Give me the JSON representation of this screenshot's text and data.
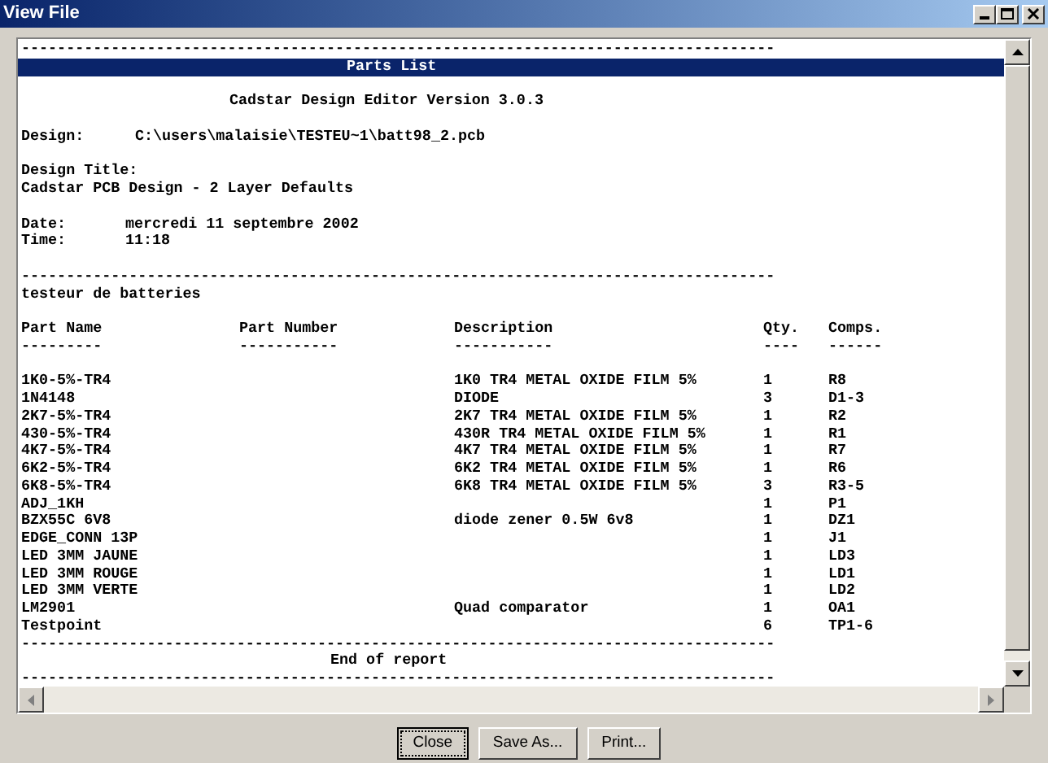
{
  "window": {
    "title": "View File"
  },
  "report": {
    "top_rule": "------------------------------------------------------------------------------------",
    "banner": "Parts List",
    "heading": "Cadstar Design Editor Version 3.0.3",
    "design": {
      "label": "Design:",
      "value": "C:\\users\\malaisie\\TESTEU~1\\batt98_2.pcb"
    },
    "design_title": {
      "label": "Design Title:",
      "value": "Cadstar PCB Design - 2 Layer Defaults"
    },
    "date": {
      "label": "Date:",
      "value": "mercredi 11 septembre 2002"
    },
    "time": {
      "label": "Time:",
      "value": "11:18"
    },
    "rule": "------------------------------------------------------------------------------------",
    "project": "testeur de batteries",
    "columns": [
      {
        "label": "Part Name",
        "underline": "---------"
      },
      {
        "label": "Part Number",
        "underline": "-----------"
      },
      {
        "label": "Description",
        "underline": "-----------"
      },
      {
        "label": "Qty.",
        "underline": "----"
      },
      {
        "label": "Comps.",
        "underline": "------"
      }
    ],
    "rows": [
      {
        "part_name": "1K0-5%-TR4",
        "description": "1K0 TR4 METAL OXIDE FILM 5%",
        "qty": "1",
        "comps": "R8"
      },
      {
        "part_name": "1N4148",
        "description": "DIODE",
        "qty": "3",
        "comps": "D1-3"
      },
      {
        "part_name": "2K7-5%-TR4",
        "description": "2K7 TR4 METAL OXIDE FILM 5%",
        "qty": "1",
        "comps": "R2"
      },
      {
        "part_name": "430-5%-TR4",
        "description": "430R TR4 METAL OXIDE FILM 5%",
        "qty": "1",
        "comps": "R1"
      },
      {
        "part_name": "4K7-5%-TR4",
        "description": "4K7 TR4 METAL OXIDE FILM 5%",
        "qty": "1",
        "comps": "R7"
      },
      {
        "part_name": "6K2-5%-TR4",
        "description": "6K2 TR4 METAL OXIDE FILM 5%",
        "qty": "1",
        "comps": "R6"
      },
      {
        "part_name": "6K8-5%-TR4",
        "description": "6K8 TR4 METAL OXIDE FILM 5%",
        "qty": "3",
        "comps": "R3-5"
      },
      {
        "part_name": "ADJ_1KH",
        "qty": "1",
        "comps": "P1"
      },
      {
        "part_name": "BZX55C 6V8",
        "description": "diode zener 0.5W 6v8",
        "qty": "1",
        "comps": "DZ1"
      },
      {
        "part_name": "EDGE_CONN 13P",
        "qty": "1",
        "comps": "J1"
      },
      {
        "part_name": "LED 3MM JAUNE",
        "qty": "1",
        "comps": "LD3"
      },
      {
        "part_name": "LED 3MM ROUGE",
        "qty": "1",
        "comps": "LD1"
      },
      {
        "part_name": "LED 3MM VERTE",
        "qty": "1",
        "comps": "LD2"
      },
      {
        "part_name": "LM2901",
        "description": "Quad comparator",
        "qty": "1",
        "comps": "OA1"
      },
      {
        "part_name": "Testpoint",
        "qty": "6",
        "comps": "TP1-6"
      }
    ],
    "end_rule": "------------------------------------------------------------------------------------",
    "end_text": "End of report",
    "bottom_rule": "------------------------------------------------------------------------------------"
  },
  "buttons": [
    {
      "label": "Close",
      "default": true
    },
    {
      "label": "Save As...",
      "default": false
    },
    {
      "label": "Print...",
      "default": false
    }
  ]
}
